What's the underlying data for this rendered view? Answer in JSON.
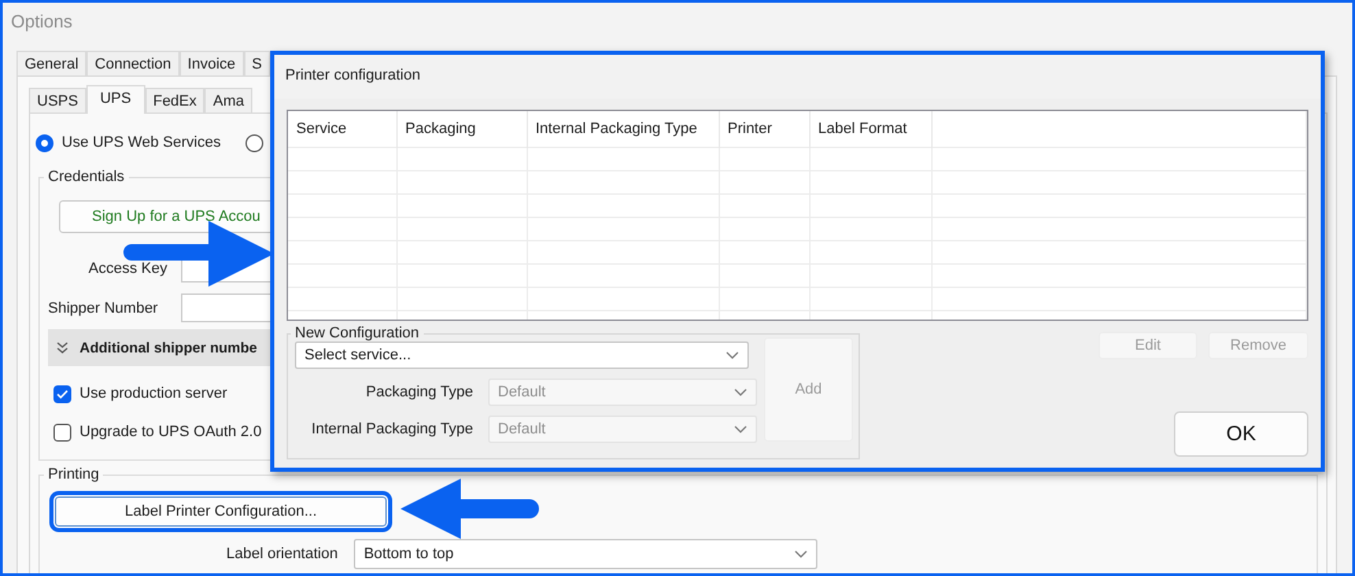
{
  "window": {
    "title": "Options"
  },
  "outer_tabs": [
    {
      "label": "General",
      "selected": false
    },
    {
      "label": "Connection",
      "selected": false
    },
    {
      "label": "Invoice",
      "selected": false
    },
    {
      "label": "S",
      "selected": false
    }
  ],
  "carrier_tabs": [
    {
      "label": "USPS",
      "selected": false
    },
    {
      "label": "UPS",
      "selected": true
    },
    {
      "label": "FedEx",
      "selected": false
    },
    {
      "label": "Ama",
      "selected": false
    }
  ],
  "service_mode": [
    {
      "label": "Use UPS Web Services",
      "selected": true
    },
    {
      "selected": false
    }
  ],
  "credentials": {
    "title": "Credentials",
    "signup_button": "Sign Up for a UPS Accou",
    "fields": [
      {
        "label": "Access Key"
      },
      {
        "label": "Shipper Number"
      }
    ],
    "additional_section": {
      "label": "Additional shipper numbe",
      "expanded": false
    },
    "options": [
      {
        "label": "Use production server",
        "checked": true
      },
      {
        "label": "Upgrade to UPS OAuth 2.0",
        "checked": false
      }
    ]
  },
  "printing": {
    "title": "Printing",
    "config_button": {
      "label": "Label Printer Configuration...",
      "highlighted": true
    },
    "orientation": {
      "label": "Label orientation",
      "value": "Bottom to top"
    }
  },
  "dialog": {
    "title": "Printer configuration",
    "table": {
      "columns": [
        "Service",
        "Packaging",
        "Internal Packaging Type",
        "Printer",
        "Label Format"
      ]
    },
    "list_buttons": [
      {
        "label": "Edit",
        "disabled": true
      },
      {
        "label": "Remove",
        "disabled": true
      }
    ],
    "new_configuration": {
      "title": "New Configuration",
      "service": {
        "value": "Select service..."
      },
      "selects": [
        {
          "label": "Packaging Type",
          "value": "Default",
          "disabled": true
        },
        {
          "label": "Internal Packaging Type",
          "value": "Default",
          "disabled": true
        }
      ],
      "add_button": {
        "label": "Add",
        "disabled": true
      }
    },
    "ok_button": "OK"
  }
}
